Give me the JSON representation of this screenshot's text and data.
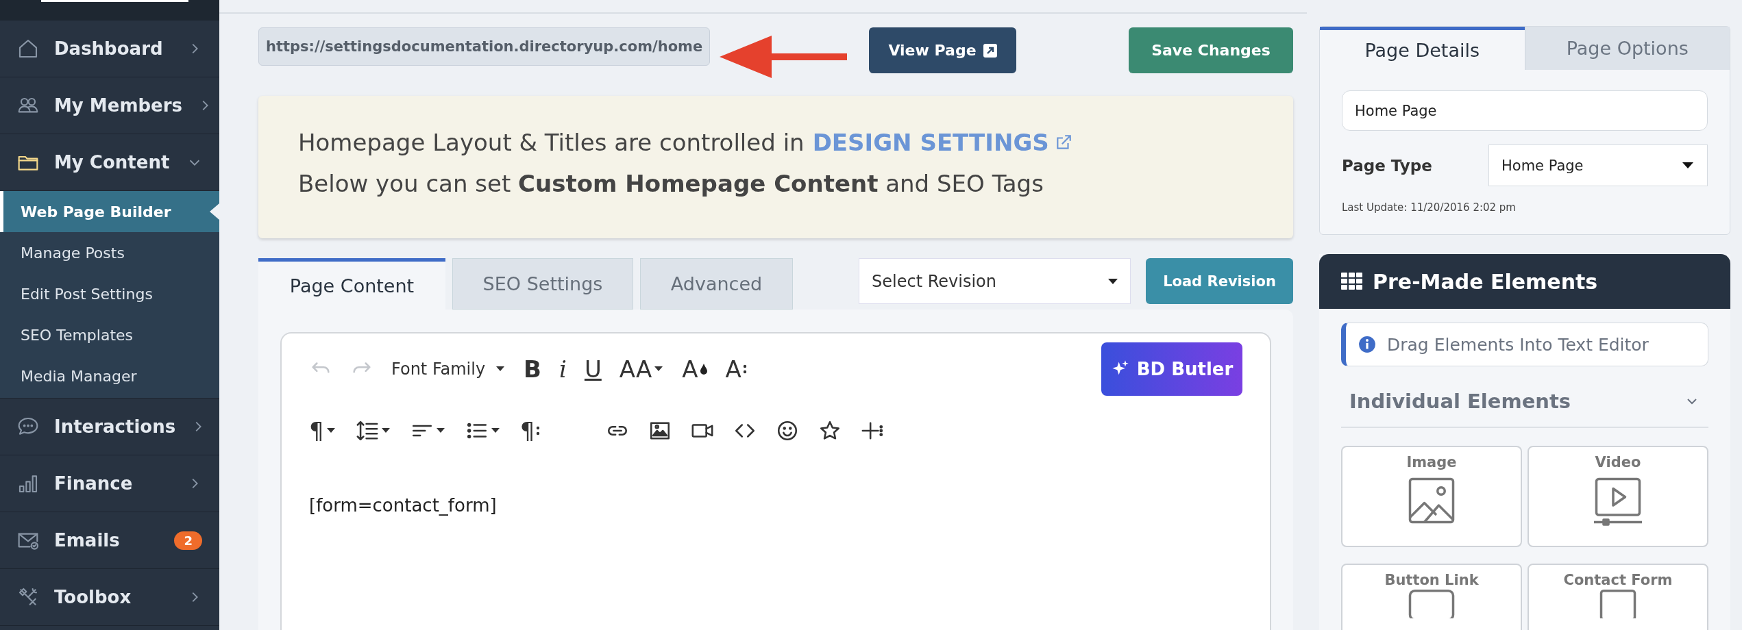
{
  "sidebar": {
    "items": [
      {
        "label": "Dashboard",
        "expanded": false
      },
      {
        "label": "My Members",
        "expanded": false
      },
      {
        "label": "My Content",
        "expanded": true,
        "children": [
          {
            "label": "Web Page Builder",
            "selected": true
          },
          {
            "label": "Manage Posts",
            "selected": false
          },
          {
            "label": "Edit Post Settings",
            "selected": false
          },
          {
            "label": "SEO Templates",
            "selected": false
          },
          {
            "label": "Media Manager",
            "selected": false
          }
        ]
      },
      {
        "label": "Interactions",
        "expanded": false
      },
      {
        "label": "Finance",
        "expanded": false
      },
      {
        "label": "Emails",
        "badge": "2"
      },
      {
        "label": "Toolbox",
        "expanded": false
      }
    ]
  },
  "top_bar": {
    "url_field": {
      "value": "https://settingsdocumentation.directoryup.com/home"
    },
    "view_page_button": "View Page",
    "save_button": "Save Changes"
  },
  "notice": {
    "line_1": "Homepage Layout & Titles are controlled in",
    "link": "DESIGN SETTINGS",
    "line_2": "Below you can set **Custom Homepage Content** and SEO Tags"
  },
  "editor_tabs": [
    {
      "label": "Page Content",
      "selected": true
    },
    {
      "label": "SEO Settings",
      "selected": false
    },
    {
      "label": "Advanced",
      "selected": false
    }
  ],
  "revision_select": {
    "value": "Select Revision"
  },
  "load_revision_button": "Load Revision",
  "toolbar": {
    "row_1": [
      {
        "kind": "undo",
        "disabled": true
      },
      {
        "kind": "redo",
        "disabled": true
      },
      {
        "kind": "font",
        "label": "Font Family",
        "caret": true
      },
      {
        "kind": "bold",
        "label": "B"
      },
      {
        "kind": "italic",
        "label": "i"
      },
      {
        "kind": "underline",
        "label": "U"
      },
      {
        "kind": "size",
        "label": "AA",
        "caret": true
      },
      {
        "kind": "color",
        "label": "A"
      },
      {
        "kind": "textmore",
        "label": "A"
      }
    ],
    "row_2": [
      {
        "kind": "paragraph",
        "label": "¶",
        "caret": true
      },
      {
        "kind": "spacing",
        "caret": true
      },
      {
        "kind": "align",
        "caret": true
      },
      {
        "kind": "list",
        "caret": true
      },
      {
        "kind": "paramore",
        "label": "¶"
      },
      {
        "kind": "link"
      },
      {
        "kind": "image"
      },
      {
        "kind": "video"
      },
      {
        "kind": "code"
      },
      {
        "kind": "emoji"
      },
      {
        "kind": "star"
      },
      {
        "kind": "insert"
      }
    ],
    "butler_button": "BD Butler"
  },
  "editor_content": "[form=contact_form]",
  "right_tabs": [
    {
      "label": "Page Details",
      "selected": true
    },
    {
      "label": "Page Options",
      "selected": false
    }
  ],
  "page_name_field": {
    "value": "Home Page"
  },
  "page_type": {
    "label": "Page Type",
    "value": "Home Page"
  },
  "last_update": "Last Update: 11/20/2016 2:02 pm",
  "premade": {
    "title": "Pre-Made Elements",
    "info": "Drag Elements Into Text Editor",
    "section": "Individual Elements",
    "tiles": [
      {
        "label": "Image",
        "kind": "image"
      },
      {
        "label": "Video",
        "kind": "video"
      },
      {
        "label": "Button Link",
        "kind": "button"
      },
      {
        "label": "Contact Form",
        "kind": "form"
      }
    ]
  }
}
